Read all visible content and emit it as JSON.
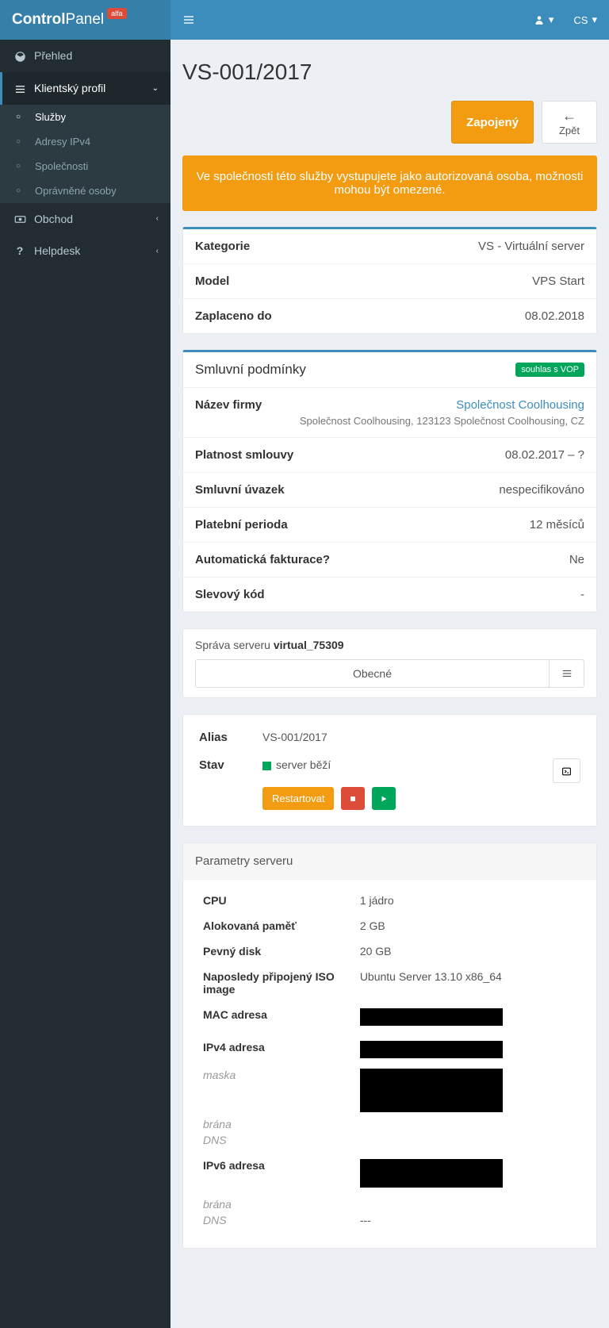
{
  "brand": {
    "part1": "Control",
    "part2": "Panel",
    "badge": "alfa"
  },
  "topbar": {
    "lang": "CS"
  },
  "sidebar": {
    "overview": "Přehled",
    "client_profile": "Klientský profil",
    "services": "Služby",
    "ipv4": "Adresy IPv4",
    "companies": "Společnosti",
    "authorized": "Oprávněné osoby",
    "shop": "Obchod",
    "helpdesk": "Helpdesk"
  },
  "page": {
    "title": "VS-001/2017"
  },
  "actions": {
    "status": "Zapojený",
    "back": "Zpět"
  },
  "alert": "Ve společnosti této služby vystupujete jako autorizovaná osoba, možnosti mohou být omezené.",
  "summary": {
    "category_label": "Kategorie",
    "category_value": "VS - Virtuální server",
    "model_label": "Model",
    "model_value": "VPS Start",
    "paid_label": "Zaplaceno do",
    "paid_value": "08.02.2018"
  },
  "contract": {
    "title": "Smluvní podmínky",
    "tag": "souhlas s VOP",
    "company_label": "Název firmy",
    "company_link": "Společnost Coolhousing",
    "company_sub": "Společnost Coolhousing, 123123 Společnost Coolhousing, CZ",
    "validity_label": "Platnost smlouvy",
    "validity_value": "08.02.2017 – ?",
    "commitment_label": "Smluvní úvazek",
    "commitment_value": "nespecifikováno",
    "period_label": "Platební perioda",
    "period_value": "12 měsíců",
    "auto_label": "Automatická fakturace?",
    "auto_value": "Ne",
    "discount_label": "Slevový kód",
    "discount_value": "-"
  },
  "server_mgmt": {
    "title_prefix": "Správa serveru ",
    "server_name": "virtual_75309",
    "tab_general": "Obecné"
  },
  "status": {
    "alias_label": "Alias",
    "alias_value": "VS-001/2017",
    "state_label": "Stav",
    "state_value": "server běží",
    "restart": "Restartovat"
  },
  "params": {
    "title": "Parametry serveru",
    "cpu_label": "CPU",
    "cpu_value": "1 jádro",
    "ram_label": "Alokovaná paměť",
    "ram_value": "2 GB",
    "disk_label": "Pevný disk",
    "disk_value": "20 GB",
    "iso_label": "Naposledy připojený ISO image",
    "iso_value": "Ubuntu Server 13.10 x86_64",
    "mac_label": "MAC adresa",
    "ipv4_label": "IPv4 adresa",
    "mask_label": "maska",
    "gateway_label": "brána",
    "dns_label": "DNS",
    "ipv6_label": "IPv6 adresa",
    "dns2_value": "---"
  }
}
